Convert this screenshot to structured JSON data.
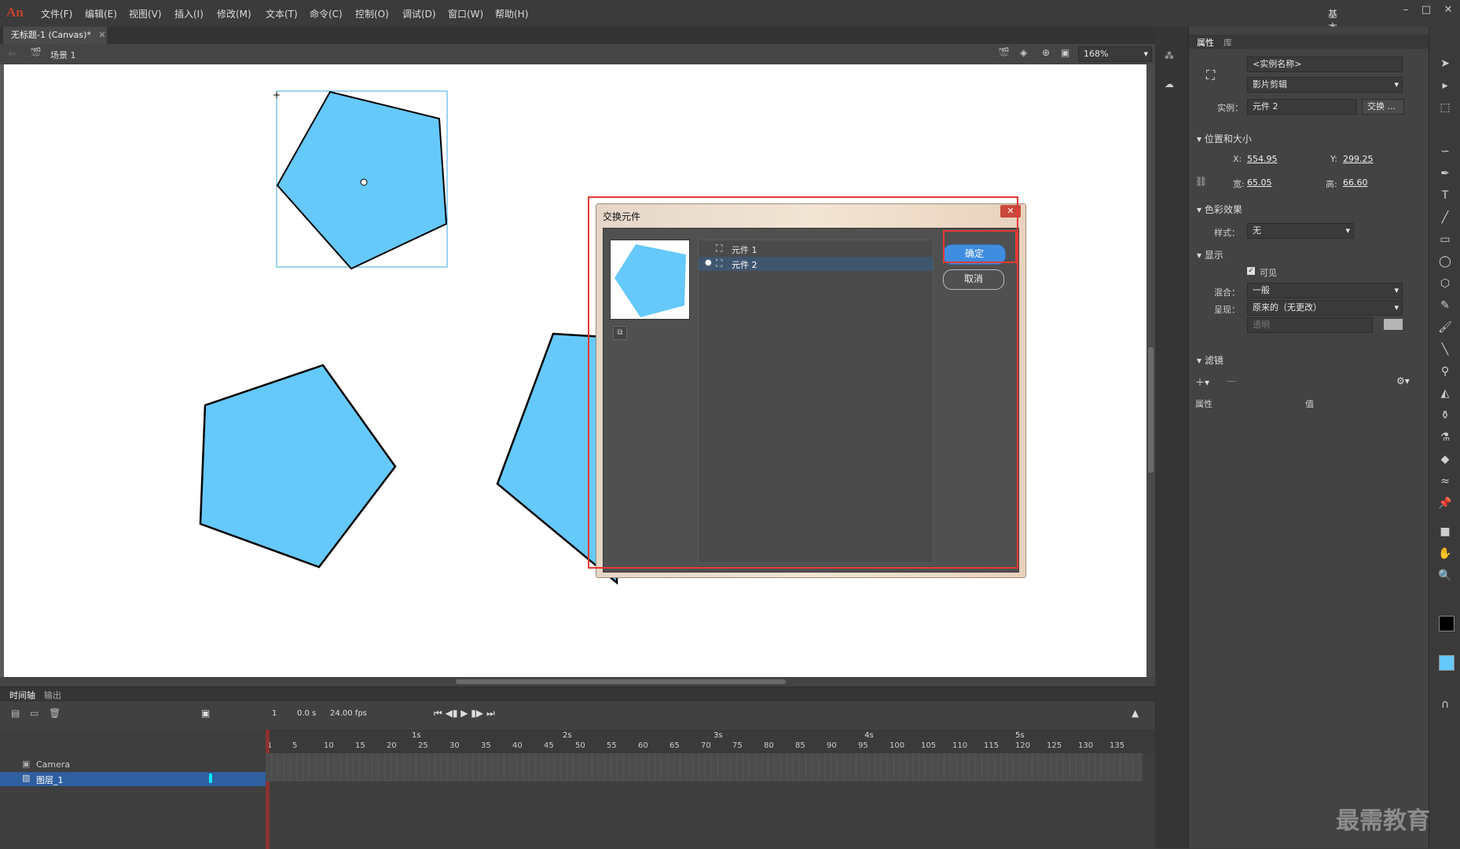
{
  "app": {
    "logo": "An"
  },
  "menu": [
    "文件(F)",
    "编辑(E)",
    "视图(V)",
    "插入(I)",
    "修改(M)",
    "文本(T)",
    "命令(C)",
    "控制(O)",
    "调试(D)",
    "窗口(W)",
    "帮助(H)"
  ],
  "workspace": "基本功能",
  "document": {
    "tab": "无标题-1 (Canvas)*",
    "scene": "场景 1",
    "zoom": "168%"
  },
  "dialog": {
    "title": "交换元件",
    "symbols": [
      {
        "name": "元件 1",
        "selected": false
      },
      {
        "name": "元件 2",
        "selected": true
      }
    ],
    "ok": "确定",
    "cancel": "取消"
  },
  "properties": {
    "tabs": [
      "属性",
      "库"
    ],
    "instance_name_placeholder": "<实例名称>",
    "type": "影片剪辑",
    "instance_label": "实例：",
    "instance_value": "元件 2",
    "swap_button": "交换 ...",
    "position_section": "位置和大小",
    "x_label": "X:",
    "x_value": "554.95",
    "y_label": "Y:",
    "y_value": "299.25",
    "w_label": "宽:",
    "w_value": "65.05",
    "h_label": "高:",
    "h_value": "66.60",
    "color_section": "色彩效果",
    "style_label": "样式：",
    "style_value": "无",
    "display_section": "显示",
    "visible_label": "可见",
    "blend_label": "混合：",
    "blend_value": "一般",
    "render_label": "呈现：",
    "render_value": "原来的（无更改）",
    "transparent": "透明",
    "filters_section": "滤镜",
    "filter_col_prop": "属性",
    "filter_col_value": "值"
  },
  "timeline": {
    "tabs": [
      "时间轴",
      "输出"
    ],
    "frame": "1",
    "time": "0.0 s",
    "fps": "24.00 fps",
    "seconds": [
      "1s",
      "2s",
      "3s",
      "4s",
      "5s"
    ],
    "frame_numbers": [
      "1",
      "5",
      "10",
      "15",
      "20",
      "25",
      "30",
      "35",
      "40",
      "45",
      "50",
      "55",
      "60",
      "65",
      "70",
      "75",
      "80",
      "85",
      "90",
      "95",
      "100",
      "105",
      "110",
      "115",
      "120",
      "125",
      "130",
      "135"
    ],
    "layers": [
      {
        "name": "Camera",
        "selected": false
      },
      {
        "name": "图层_1",
        "selected": true
      }
    ]
  },
  "watermark": "最需教育",
  "colors": {
    "shape_fill": "#66c9fb",
    "accent": "#3f8de0",
    "highlight": "#e53935"
  }
}
